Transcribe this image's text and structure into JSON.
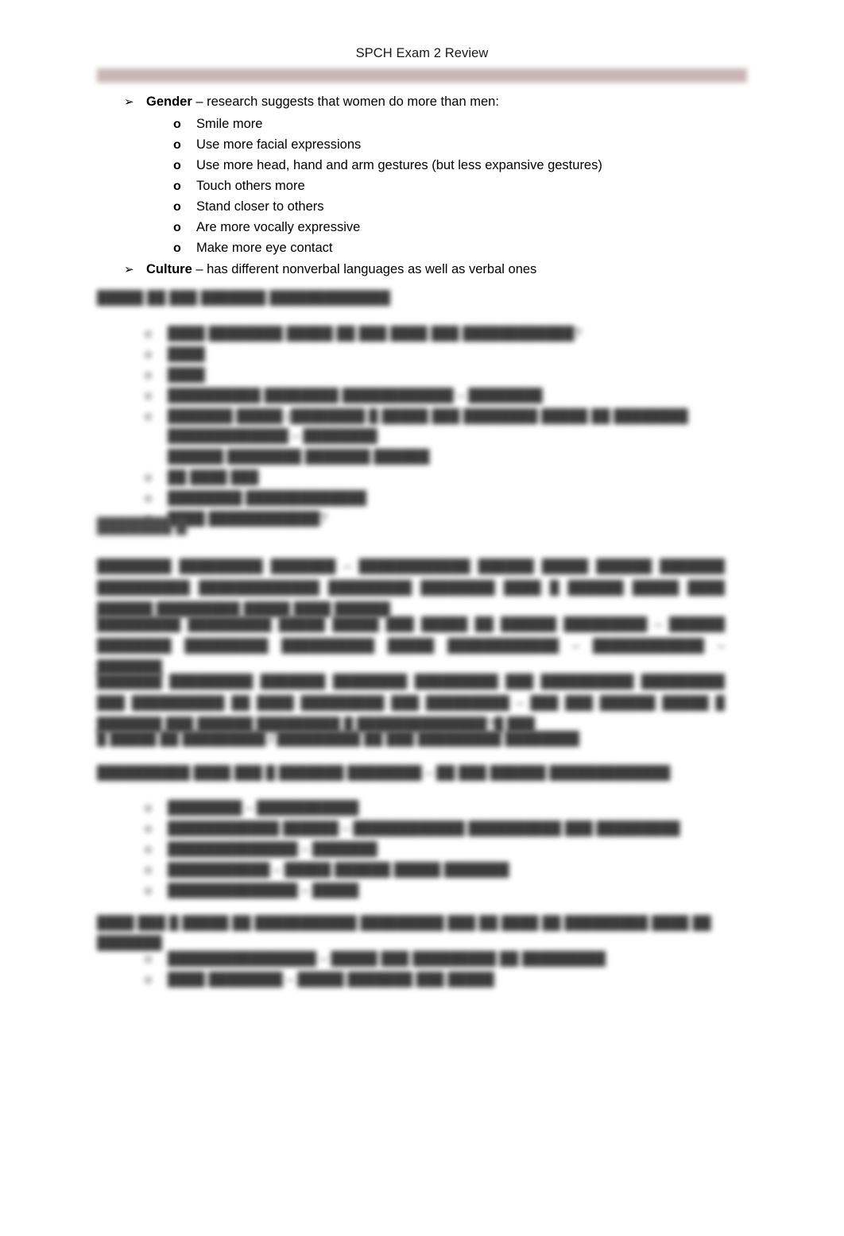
{
  "document": {
    "header_title": "SPCH Exam 2 Review",
    "page_background": "#ffffff",
    "rule_color": "#c6b2b2"
  },
  "visible_content": {
    "sections": [
      {
        "marker": "➢",
        "bold_lead": "Gender",
        "rest": " – research suggests that women do more than men:",
        "subitems": [
          {
            "marker": "o",
            "text": "Smile more"
          },
          {
            "marker": "o",
            "text": "Use more facial expressions"
          },
          {
            "marker": "o",
            "text": "Use more head, hand and arm gestures (but less expansive gestures)"
          },
          {
            "marker": "o",
            "text": "Touch others more"
          },
          {
            "marker": "o",
            "text": "Stand closer to others"
          },
          {
            "marker": "o",
            "text": "Are more vocally expressive"
          },
          {
            "marker": "o",
            "text": "Make more eye contact"
          }
        ]
      },
      {
        "marker": "➢",
        "bold_lead": "Culture",
        "rest": " – has different nonverbal languages as well as verbal ones",
        "subitems": []
      }
    ]
  },
  "redacted_content": {
    "note": "Remaining page text is visually blurred/illegible in the source image.",
    "heading_1": "█████ ██ ███ ███████ █████████████",
    "list_1": [
      {
        "marker": "o",
        "text": "████ ████████ █████ ██ ███ ████ ███ ████████████?"
      },
      {
        "marker": "o",
        "text": "████"
      },
      {
        "marker": "o",
        "text": "████"
      },
      {
        "marker": "o",
        "text": "██████████ ████████ ████████████ – ████████"
      },
      {
        "marker": "o",
        "text": "███████ █████ (████████ █ █████ ███ ████████ █████ ██ ████████ █████████████ – ████████"
      },
      {
        "marker": "",
        "text": "██████ ████████ ███████ ██████"
      },
      {
        "marker": "o",
        "text": "██ ████ ███"
      },
      {
        "marker": "o",
        "text": "████████ █████████████"
      },
      {
        "marker": "o",
        "text": "████ ████████████?"
      }
    ],
    "chapter_heading": "███████ █",
    "paragraph_1_bold": "████████ █████████",
    "paragraph_1_rest": " ███████ – ████████████ ██████ █████ ██████ ███████ ██████████ █████████████ █████████ ████████ ████ █ ██████ █████ ████ ██████ █████████ █████ ████ ██████",
    "paragraph_2_bold": "█████████ █████████",
    "paragraph_2_rest": " █████ █████ ███ █████ ██ ██████ █████████ – ██████ ████████ █████████ ██████████ █████ ████████████ – ████████████ – ███████",
    "paragraph_3_bold": "███████ █████████",
    "paragraph_3_rest": " ███████ ████████ █████████ ███ ██████████ █████████ ███ ██████████ ██ ████ █████████ ███ █████████ – ███ ███ ██████ █████ █ ███████ ███ ██████ █████████ █ ██████████████?█ ███",
    "heading_2": "█ █████ ██ █████████ / █████████ ██ ███ █████████ ████████",
    "subtext_1": "██████████ ████ ███ █ ███████ ████████ – ██ ███ ██████ █████████████",
    "list_2": [
      {
        "marker": "o",
        "bold": "████████",
        "rest": " – ███████████"
      },
      {
        "marker": "o",
        "bold": "████████████ ██████",
        "rest": " – ████████████ ██████████ ███ █████████"
      },
      {
        "marker": "o",
        "bold": "██████████████",
        "rest": " – ███████"
      },
      {
        "marker": "o",
        "bold": "███████████",
        "rest": " – █████ ██████ █████ ███████"
      },
      {
        "marker": "o",
        "bold": "██████████████",
        "rest": " – █████"
      }
    ],
    "heading_3": "████ ███ █ █████ ██ ███████████ █████████ ███ ██ ████ ██ █████████ ████ ██ ███████",
    "list_3": [
      {
        "marker": "o",
        "bold": "████████████████",
        "rest": " – █████ ███ █████████ ██ █████████"
      },
      {
        "marker": "o",
        "bold": "████ ████████",
        "rest": " – █████ ███████ ███ █████"
      }
    ]
  }
}
